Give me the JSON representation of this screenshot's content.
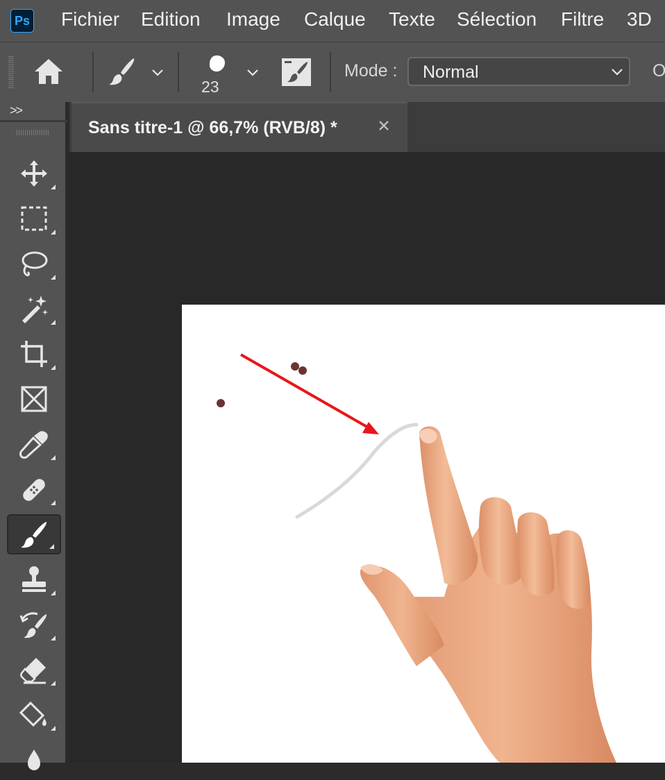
{
  "app": {
    "logo_text": "Ps",
    "brand_color": "#31a8ff"
  },
  "menu": {
    "items": [
      {
        "label": "Fichier"
      },
      {
        "label": "Edition"
      },
      {
        "label": "Image"
      },
      {
        "label": "Calque"
      },
      {
        "label": "Texte"
      },
      {
        "label": "Sélection"
      },
      {
        "label": "Filtre"
      },
      {
        "label": "3D"
      }
    ]
  },
  "options": {
    "brush_size": "23",
    "mode_label": "Mode :",
    "mode_value": "Normal",
    "opacity_label_cut": "O"
  },
  "toolbar": {
    "collapse_label": ">>",
    "tools": [
      {
        "name": "move-tool",
        "icon": "move-icon"
      },
      {
        "name": "marquee-tool",
        "icon": "marquee-icon"
      },
      {
        "name": "lasso-tool",
        "icon": "lasso-icon"
      },
      {
        "name": "magic-wand-tool",
        "icon": "magic-wand-icon"
      },
      {
        "name": "crop-tool",
        "icon": "crop-icon"
      },
      {
        "name": "frame-tool",
        "icon": "frame-icon"
      },
      {
        "name": "eyedropper-tool",
        "icon": "eyedropper-icon"
      },
      {
        "name": "healing-brush-tool",
        "icon": "bandage-icon"
      },
      {
        "name": "brush-tool",
        "icon": "brush-icon",
        "active": true
      },
      {
        "name": "clone-stamp-tool",
        "icon": "stamp-icon"
      },
      {
        "name": "history-brush-tool",
        "icon": "history-brush-icon"
      },
      {
        "name": "eraser-tool",
        "icon": "eraser-icon"
      },
      {
        "name": "paint-bucket-tool",
        "icon": "paint-bucket-icon"
      },
      {
        "name": "blur-tool",
        "icon": "blur-drop-icon"
      }
    ]
  },
  "document": {
    "tab_title": "Sans titre-1 @ 66,7% (RVB/8) *"
  },
  "colors": {
    "annotation_arrow": "#e8161b",
    "paint_dots": "#6b3434",
    "stroke": "#d6d6d6",
    "skin": "#e8a07a"
  }
}
